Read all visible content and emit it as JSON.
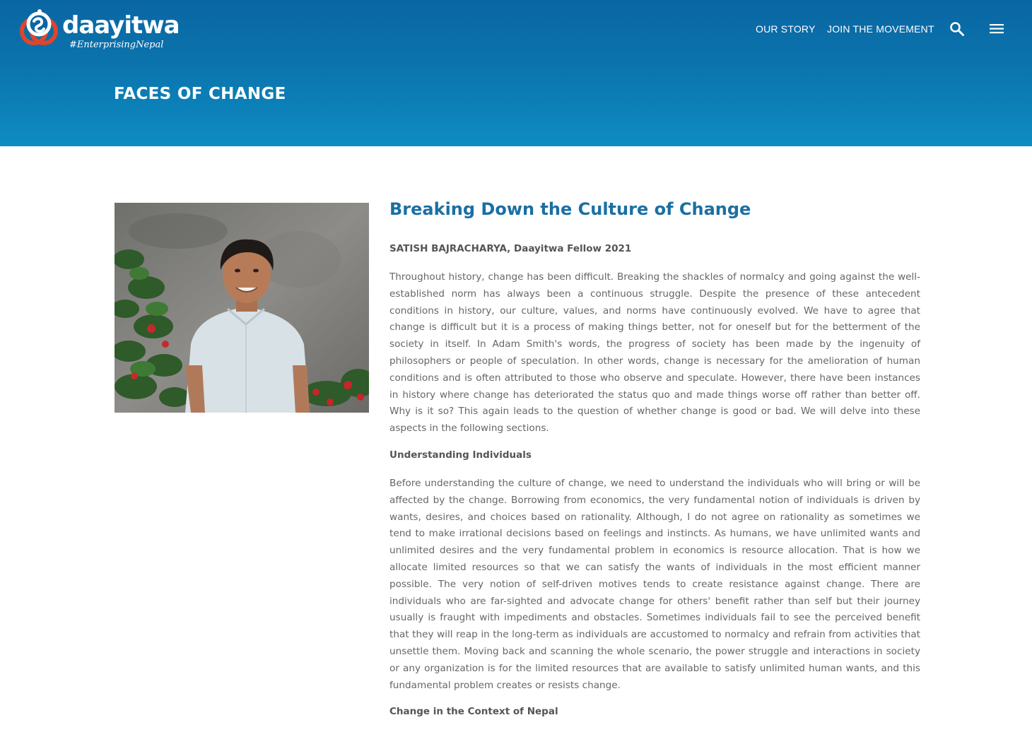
{
  "brand": {
    "name": "daayitwa",
    "tagline": "#EnterprisingNepal"
  },
  "nav": {
    "links": [
      "OUR STORY",
      "JOIN THE MOVEMENT"
    ],
    "search_icon": "search-icon",
    "menu_icon": "hamburger-menu-icon"
  },
  "hero": {
    "title": "FACES OF CHANGE"
  },
  "article": {
    "title": "Breaking Down the Culture of Change",
    "byline": "SATISH BAJRACHARYA, Daayitwa Fellow 2021",
    "paragraph_1": "Throughout history, change has been difficult. Breaking the shackles of normalcy and going against the well-established norm has always been a continuous struggle. Despite the presence of these antecedent conditions in history, our culture, values, and norms have continuously evolved. We have to agree that change is difficult but it is a process of making things better, not for oneself but for the betterment of the society in itself. In Adam Smith's words, the progress of society has been made by the ingenuity of philosophers or people of speculation. In other words, change is necessary for the amelioration of human conditions and is often attributed to those who observe and speculate. However, there have been instances in history where change has deteriorated the status quo and made things worse off rather than better off. Why is it so? This again leads to the question of whether change is good or bad. We will delve into these aspects in the following sections.",
    "subheading_1": "Understanding Individuals",
    "paragraph_2": "Before understanding the culture of change, we need to understand the individuals who will bring or will be affected by the change. Borrowing from economics, the very fundamental notion of individuals is driven by wants, desires, and choices based on rationality. Although, I do not agree on rationality as sometimes we tend to make irrational decisions based on feelings and instincts. As humans, we have unlimited wants and unlimited desires and the very fundamental problem in economics is resource allocation. That is how we allocate limited resources so that we can satisfy the wants of individuals in the most efficient manner possible. The very notion of self-driven motives tends to create resistance against change. There are individuals who are far-sighted and advocate change for others' benefit rather than self but their journey usually is fraught with impediments and obstacles. Sometimes individuals fail to see the perceived benefit that they will reap in the long-term as individuals are accustomed to normalcy and refrain from activities that unsettle them. Moving back and scanning the whole scenario, the power struggle and interactions in society or any organization is for the limited resources that are available to satisfy unlimited human wants, and this fundamental problem creates or resists change.",
    "subheading_2": "Change in the Context of Nepal"
  },
  "colors": {
    "header_top": "#0a66a3",
    "header_bottom": "#0e8cc3",
    "title_blue": "#1b6fa3",
    "logo_red": "#e0452b"
  }
}
